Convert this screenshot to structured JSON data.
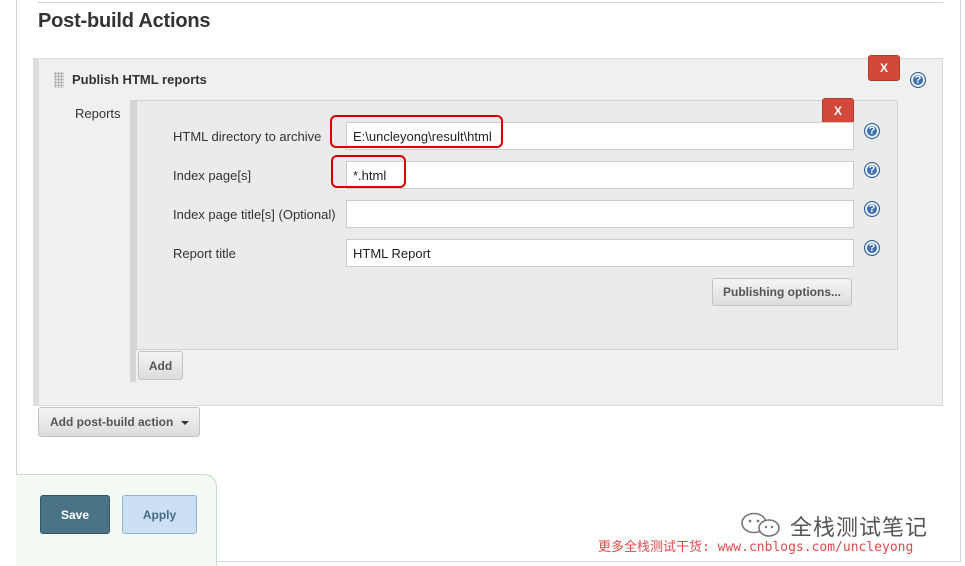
{
  "section": {
    "title": "Post-build Actions"
  },
  "step": {
    "title": "Publish HTML reports",
    "delete_label": "X",
    "reports_label": "Reports",
    "report_delete_label": "X",
    "fields": [
      {
        "label": "HTML directory to archive",
        "value": "E:\\uncleyong\\result\\html"
      },
      {
        "label": "Index page[s]",
        "value": "*.html"
      },
      {
        "label": "Index page title[s] (Optional)",
        "value": ""
      },
      {
        "label": "Report title",
        "value": "HTML Report"
      }
    ],
    "publishing_options_label": "Publishing options...",
    "add_label": "Add"
  },
  "add_post_build_label": "Add post-build action",
  "footer": {
    "save_label": "Save",
    "apply_label": "Apply"
  },
  "watermark": {
    "title": "全栈测试笔记",
    "subtitle": "更多全栈测试干货: www.cnblogs.com/uncleyong"
  },
  "colors": {
    "delete_red": "#d24939",
    "highlight_red": "#d80000",
    "save_bg": "#4a7486",
    "apply_bg": "#cbe0f2",
    "help_blue": "#3f6fae"
  }
}
